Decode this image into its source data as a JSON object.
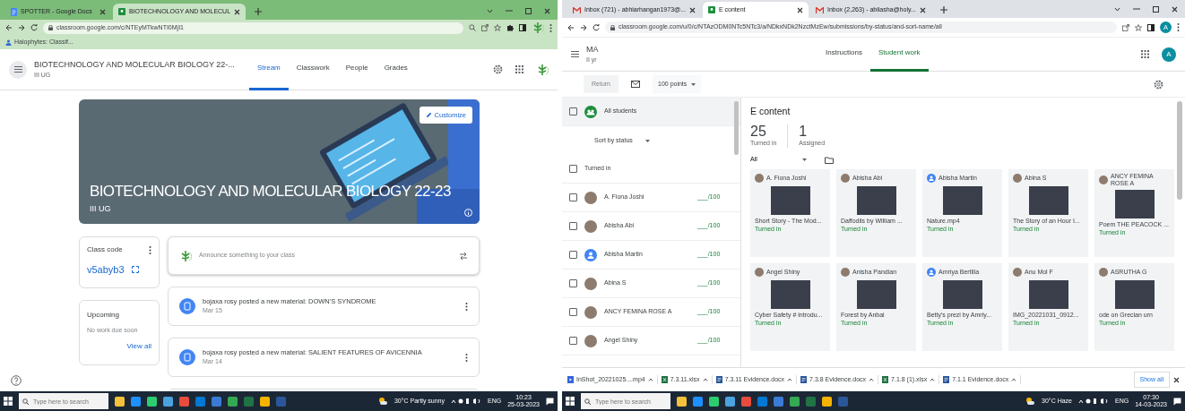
{
  "left_window": {
    "browser_tabs": [
      {
        "title": "SPOTTER - Google Docs",
        "kind": "docs",
        "selected": false
      },
      {
        "title": "BIOTECHNOLOGY AND MOLECUL",
        "kind": "classroom",
        "selected": true
      }
    ],
    "url": "classroom.google.com/c/NTEyMTkwNTI0MjI1",
    "bookmarks": [
      "Halophytes: Classif..."
    ],
    "class_header": {
      "title": "BIOTECHNOLOGY AND MOLECULAR BIOLOGY 22-...",
      "subtitle": "III UG",
      "tabs": [
        {
          "label": "Stream",
          "selected": true
        },
        {
          "label": "Classwork",
          "selected": false
        },
        {
          "label": "People",
          "selected": false
        },
        {
          "label": "Grades",
          "selected": false
        }
      ]
    },
    "banner": {
      "title": "BIOTECHNOLOGY AND MOLECULAR BIOLOGY 22-23",
      "subtitle": "III UG",
      "button": "Customize"
    },
    "class_code": {
      "label": "Class code",
      "code": "v5abyb3"
    },
    "upcoming": {
      "title": "Upcoming",
      "message": "No work due soon",
      "link": "View all"
    },
    "announce": "Announce something to your class",
    "posts": [
      {
        "text": "bojaxa rosy posted a new material: DOWN'S SYNDROME",
        "date": "Mar 15"
      },
      {
        "text": "bojaxa rosy posted a new material: SALIENT FEATURES OF AVICENNIA",
        "date": "Mar 14"
      }
    ],
    "taskbar": {
      "search_placeholder": "Type here to search",
      "weather": "30°C Partly sunny",
      "language": "ENG",
      "time": "10:23",
      "date": "25-03-2023"
    }
  },
  "right_window": {
    "browser_tabs": [
      {
        "title": "Inbox (721) - abhiarhangan1973@...",
        "kind": "mail",
        "selected": false
      },
      {
        "title": "E content",
        "kind": "classroom",
        "selected": true
      },
      {
        "title": "Inbox (2,263) - abilasha@holy...",
        "kind": "mail",
        "selected": false
      }
    ],
    "url": "classroom.google.com/u/0/c/NTAzODM0NTc5NTc3/a/NDkxNDk2NzctMzEw/submissions/by-status/and-sort-name/all",
    "toolbar_profile_initial": "A",
    "profile_initial": "A",
    "class_header": {
      "title": "MA",
      "subtitle": "II yr",
      "tabs": [
        {
          "label": "Instructions",
          "selected": false
        },
        {
          "label": "Student work",
          "selected": true
        }
      ]
    },
    "toolbar": {
      "return_button": "Return",
      "return_disabled": true,
      "points": "100 points"
    },
    "student_list": {
      "all_students": "All students",
      "all_checked": false,
      "sort": "Sort by status",
      "group": "Turned in",
      "group_checked": false,
      "students": [
        {
          "name": "A. Fiona Joshi",
          "grade": "___/100",
          "checked": false,
          "kind": "photo"
        },
        {
          "name": "Abisha Abi",
          "grade": "___/100",
          "checked": false,
          "kind": "photo"
        },
        {
          "name": "Abisha Martin",
          "grade": "___/100",
          "checked": false,
          "kind": "default"
        },
        {
          "name": "Abina S",
          "grade": "___/100",
          "checked": false,
          "kind": "photo"
        },
        {
          "name": "ANCY FEMINA ROSE A",
          "grade": "___/100",
          "checked": false,
          "kind": "photo"
        },
        {
          "name": "Angel Shiny",
          "grade": "___/100",
          "checked": false,
          "kind": "photo"
        }
      ]
    },
    "assignment": {
      "title": "E content",
      "stats": [
        {
          "count": "25",
          "label": "Turned in"
        },
        {
          "count": "1",
          "label": "Assigned"
        }
      ],
      "filter": "All",
      "submissions": [
        {
          "name": "A. Fiona Joshi",
          "kind": "photo",
          "file": "Short Story - The Mod...",
          "status": "Turned in"
        },
        {
          "name": "Abisha Abi",
          "kind": "photo",
          "file": "Daffodils by William ...",
          "status": "Turned in"
        },
        {
          "name": "Abisha Martin",
          "kind": "default",
          "file": "Nature.mp4",
          "status": "Turned in"
        },
        {
          "name": "Abina S",
          "kind": "photo",
          "file": "The Story of an Hour I...",
          "status": "Turned in"
        },
        {
          "name": "ANCY FEMINA ROSE A",
          "kind": "photo",
          "file": "Poem THE PEACOCK ...",
          "status": "Turned in"
        },
        {
          "name": "Angel Shiny",
          "kind": "photo",
          "file": "Cyber Safety # introdu...",
          "status": "Turned in"
        },
        {
          "name": "Anisha Pandian",
          "kind": "photo",
          "file": "Forest by Anbai",
          "status": "Turned in"
        },
        {
          "name": "Amriya Bertilla",
          "kind": "default",
          "file": "Betty's prezi by Amriy...",
          "status": "Turned in"
        },
        {
          "name": "Anu Mol F",
          "kind": "photo",
          "file": "IMG_20221031_0912...",
          "status": "Turned in"
        },
        {
          "name": "ASRUTHA G",
          "kind": "photo",
          "file": "ode on Grecian urn",
          "status": "Turned in"
        }
      ]
    },
    "downloads": {
      "items": [
        {
          "name": "InShot_20221025....mp4",
          "kind": "video"
        },
        {
          "name": "7.3.11.xlsx",
          "kind": "spreadsheet"
        },
        {
          "name": "7.3.11 Evidence.docx",
          "kind": "document"
        },
        {
          "name": "7.3.8 Evidence.docx",
          "kind": "document"
        },
        {
          "name": "7.1.8 (1).xlsx",
          "kind": "spreadsheet"
        },
        {
          "name": "7.1.1 Evidence.docx",
          "kind": "document"
        }
      ],
      "show_all": "Show all"
    },
    "taskbar": {
      "search_placeholder": "Type here to search",
      "weather": "30°C Haze",
      "language": "ENG",
      "time": "07:30",
      "date": "14-03-2023"
    }
  }
}
